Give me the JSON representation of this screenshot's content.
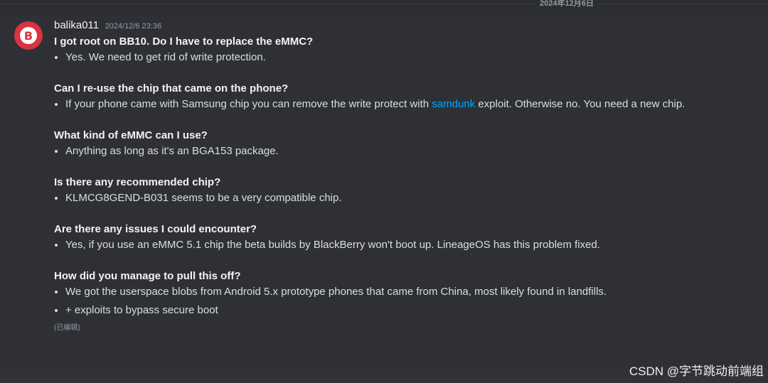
{
  "date_divider": "2024年12月6日",
  "avatar_letter": "B",
  "message": {
    "username": "balika011",
    "timestamp": "2024/12/6 23:36",
    "sections": [
      {
        "question": "I got root on BB10. Do I have to replace the eMMC?",
        "answers": [
          {
            "text": "Yes. We need to get rid of write protection."
          }
        ]
      },
      {
        "question": "Can I re-use the chip that came on the phone?",
        "answers": [
          {
            "before": "If your phone came with Samsung chip you can remove the write protect with ",
            "link": "samdunk",
            "after": " exploit. Otherwise no. You need a new chip."
          }
        ]
      },
      {
        "question": "What kind of eMMC can I use?",
        "answers": [
          {
            "text": "Anything as long as it's an BGA153 package."
          }
        ]
      },
      {
        "question": "Is there any recommended chip?",
        "answers": [
          {
            "text": "KLMCG8GEND-B031 seems to be a very compatible chip."
          }
        ]
      },
      {
        "question": "Are there any issues I could encounter?",
        "answers": [
          {
            "text": "Yes, if you use an eMMC 5.1 chip the beta builds by BlackBerry won't boot up. LineageOS has this problem fixed."
          }
        ]
      },
      {
        "question": "How did you manage to pull this off?",
        "answers": [
          {
            "text": "We got the userspace blobs from Android 5.x prototype phones that came from China, most likely found in landfills."
          },
          {
            "text": "+ exploits to bypass secure boot"
          }
        ]
      }
    ],
    "edited_label": "(已编辑)"
  },
  "watermark": "CSDN @字节跳动前端组",
  "colors": {
    "background": "#313338",
    "message_hover": "#2e3035",
    "avatar_red": "#d9343f",
    "link": "#00a8fc"
  }
}
